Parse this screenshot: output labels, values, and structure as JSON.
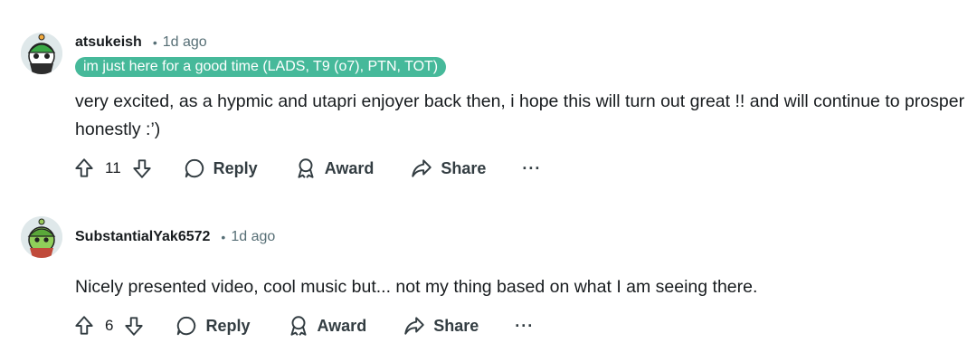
{
  "comments": [
    {
      "username": "atsukeish",
      "separator": "•",
      "time": "1d ago",
      "flair": "im just here for a good time (LADS, T9 (o7), PTN, TOT)",
      "avatar_icon": "snoo-avatar-icon",
      "body": "very excited, as a hypmic and utapri enjoyer back then, i hope this will turn out great !! and will continue to prosper honestly :’)",
      "votes": "11",
      "reply_label": "Reply",
      "award_label": "Award",
      "share_label": "Share",
      "more_label": "···"
    },
    {
      "username": "SubstantialYak6572",
      "separator": "•",
      "time": "1d ago",
      "flair": "",
      "avatar_icon": "snoo-avatar-icon",
      "body": "Nicely presented video, cool music but... not my thing based on what I am seeing there.",
      "votes": "6",
      "reply_label": "Reply",
      "award_label": "Award",
      "share_label": "Share",
      "more_label": "···"
    }
  ],
  "colors": {
    "flair_bg": "#46b99a",
    "meta_text": "#576f76",
    "action_text": "#333d42"
  }
}
